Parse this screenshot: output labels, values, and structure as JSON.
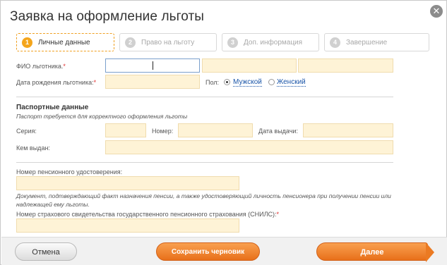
{
  "dialog": {
    "title": "Заявка на оформление льготы",
    "close_icon": "close-icon"
  },
  "steps": [
    {
      "num": "1",
      "label": "Личные данные",
      "active": true
    },
    {
      "num": "2",
      "label": "Право на льготу",
      "active": false
    },
    {
      "num": "3",
      "label": "Доп. информация",
      "active": false
    },
    {
      "num": "4",
      "label": "Завершение",
      "active": false
    }
  ],
  "personal": {
    "fio_label": "ФИО льготника.",
    "birth_label": "Дата рождения льготника:",
    "gender_label": "Пол:",
    "gender_options": [
      "Мужской",
      "Женский"
    ],
    "gender_selected": "Мужской",
    "required_mark": "*"
  },
  "passport": {
    "section_title": "Паспортные данные",
    "note": "Паспорт требуется для корректного оформления льготы",
    "series_label": "Серия:",
    "number_label": "Номер:",
    "issue_date_label": "Дата выдачи:",
    "issued_by_label": "Кем выдан:"
  },
  "pension": {
    "cert_label": "Номер пенсионного удостоверения:",
    "note_line1": "Документ, подтверждающий факт назначения пенсии, а также удостоверяющий личность пенсионера при получении пенсии или",
    "note_line2": "надлежащей ему льготы.",
    "snils_label": "Номер страхового свидетельства государственного пенсионного страхования (СНИЛС):"
  },
  "footer": {
    "cancel_label": "Отмена",
    "draft_label": "Сохранить черновик",
    "next_label": "Далее"
  },
  "colors": {
    "accent": "#f4a51c",
    "input_bg": "#fef3d6",
    "link": "#1a55a8",
    "button_orange": "#e8701a"
  }
}
